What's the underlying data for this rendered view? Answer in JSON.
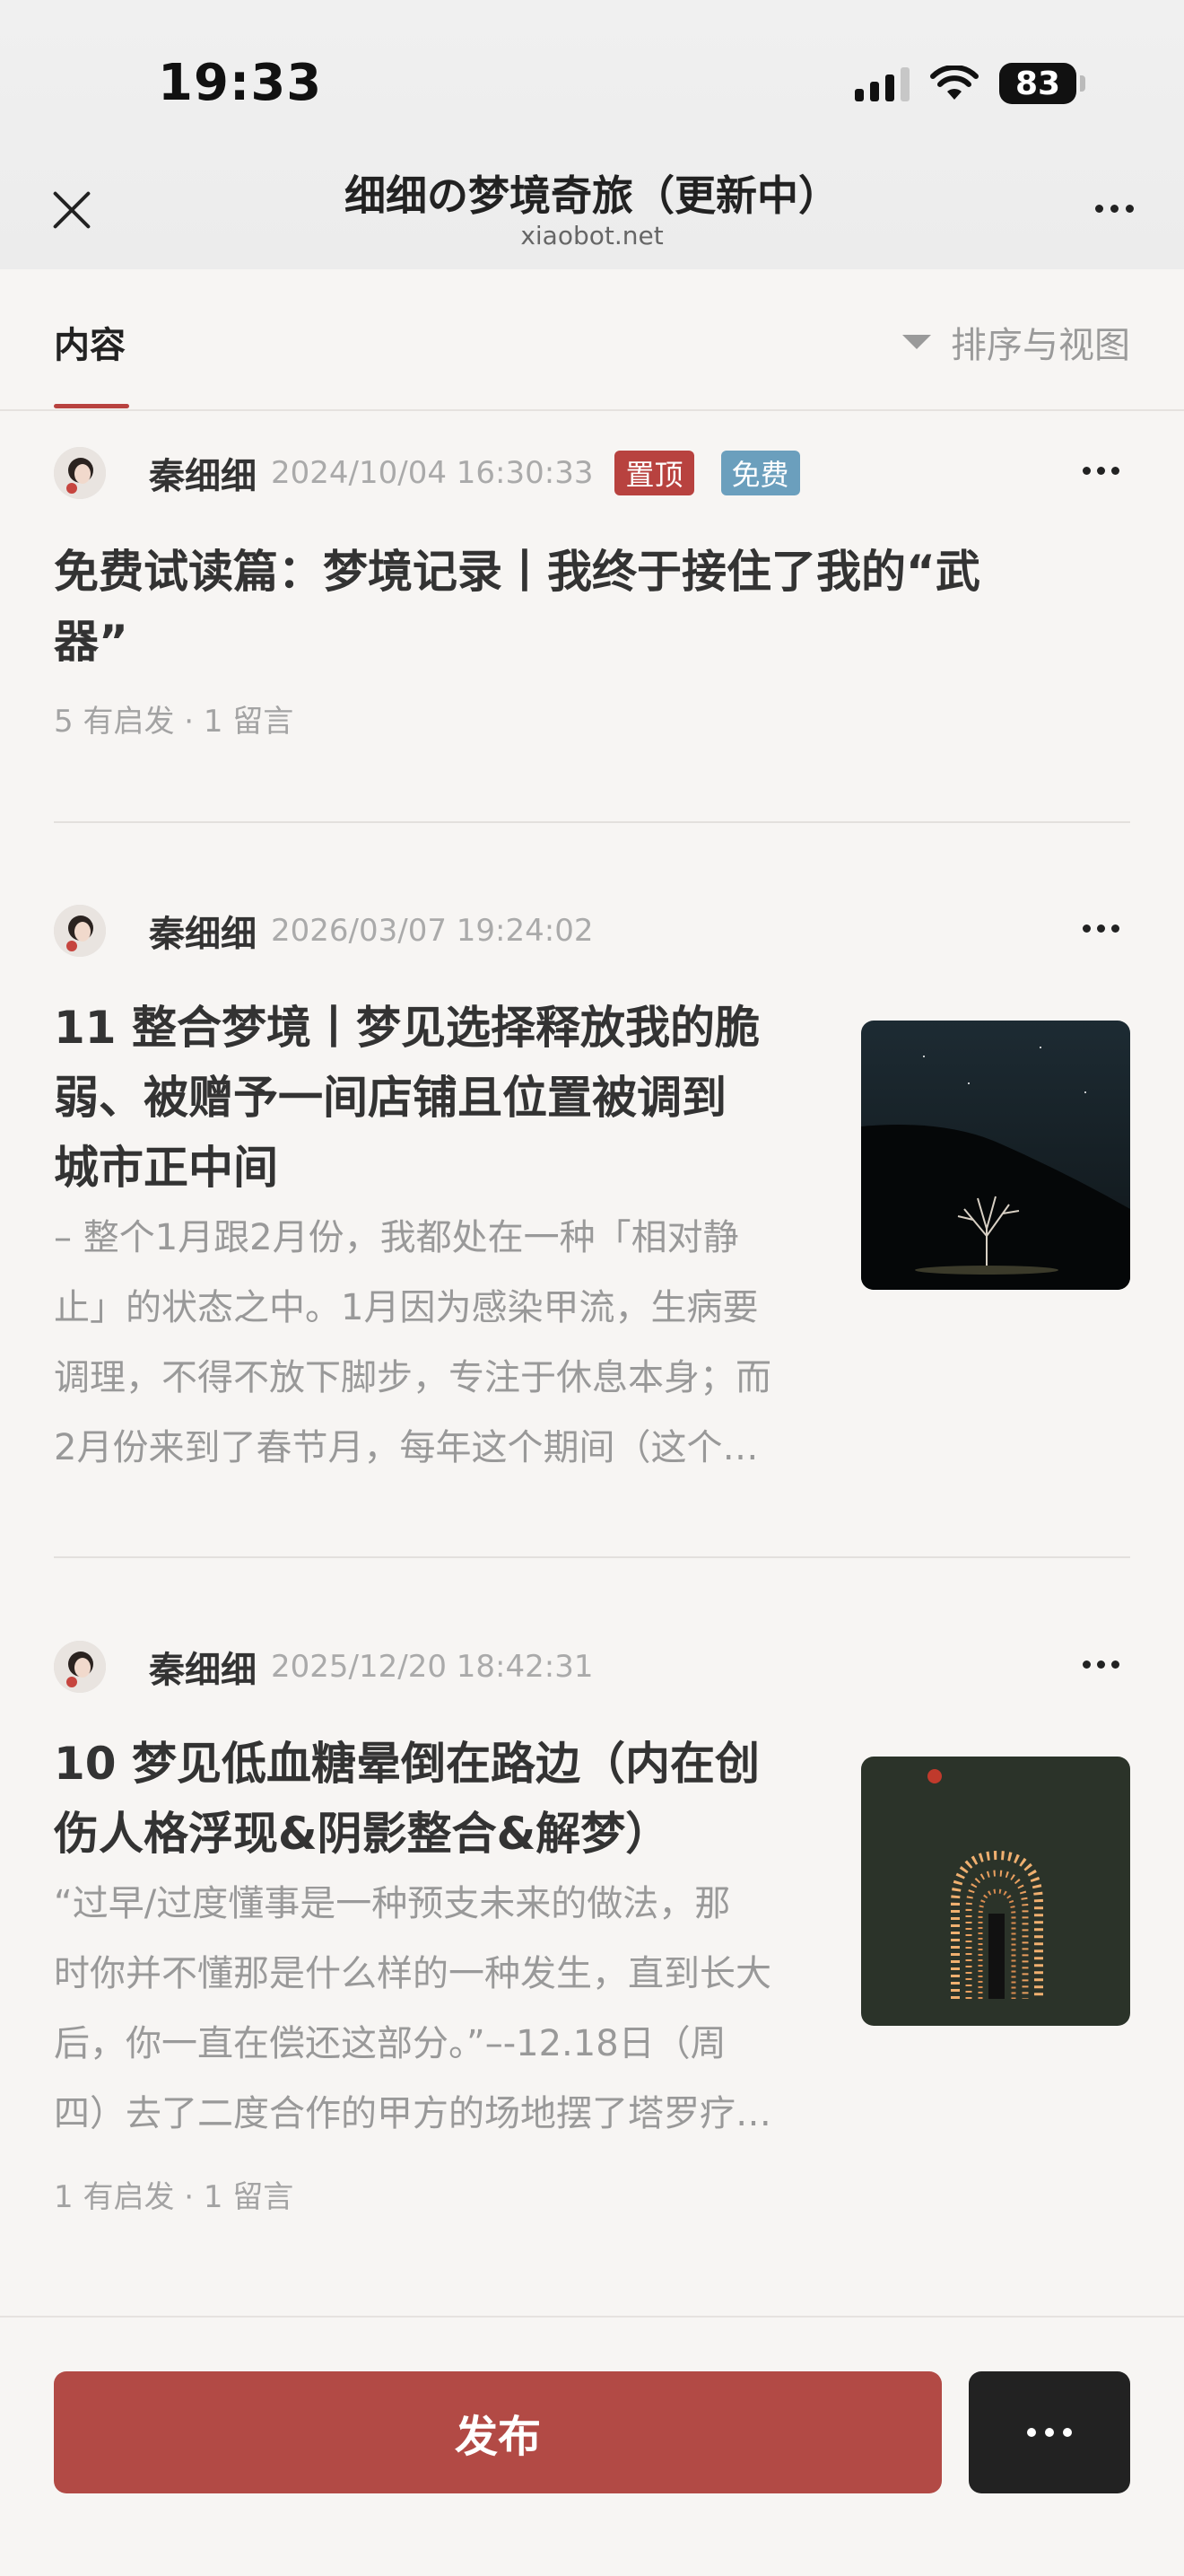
{
  "status_bar": {
    "time": "19:33",
    "battery": "83"
  },
  "header": {
    "title": "细细の梦境奇旅（更新中）",
    "subtitle": "xiaobot.net"
  },
  "tabs": {
    "content_label": "内容",
    "sort_label": "排序与视图"
  },
  "posts": [
    {
      "author": "秦细细",
      "date": "2024/10/04 16:30:33",
      "badges": [
        "置顶",
        "免费"
      ],
      "title": "免费试读篇：梦境记录丨我终于接住了我的“武器”",
      "title_line1": "免费试读篇：梦境记录丨我终于接住了我的“武",
      "title_line2": "器”",
      "stats": "5 有启发 · 1 留言"
    },
    {
      "author": "秦细细",
      "date": "2026/03/07 19:24:02",
      "title_lines": [
        "11 整合梦境丨梦见选择释放我的脆",
        "弱、被赠予一间店铺且位置被调到",
        "城市正中间"
      ],
      "excerpt_lines": [
        "– 整个1月跟2月份，我都处在一种「相对静",
        "止」的状态之中。1月因为感染甲流，生病要",
        "调理，不得不放下脚步，专注于休息本身；而",
        "2月份来到了春节月，每年这个期间（这个…"
      ],
      "thumb": "night-tree-image"
    },
    {
      "author": "秦细细",
      "date": "2025/12/20 18:42:31",
      "title_lines": [
        "10 梦见低血糖晕倒在路边（内在创",
        "伤人格浮现&阴影整合&解梦）"
      ],
      "excerpt_lines": [
        "“过早/过度懂事是一种预支未来的做法，那",
        "时你并不懂那是什么样的一种发生，直到长大",
        "后，你一直在偿还这部分。”–-12.18日（周",
        "四）去了二度合作的甲方的场地摆了塔罗疗…"
      ],
      "stats": "1 有启发 · 1 留言",
      "thumb": "light-tunnel-image"
    }
  ],
  "bottom": {
    "publish_label": "发布"
  },
  "colors": {
    "accent": "#b8423f",
    "publish": "#b24a45",
    "free_badge": "#6b9fbd"
  }
}
